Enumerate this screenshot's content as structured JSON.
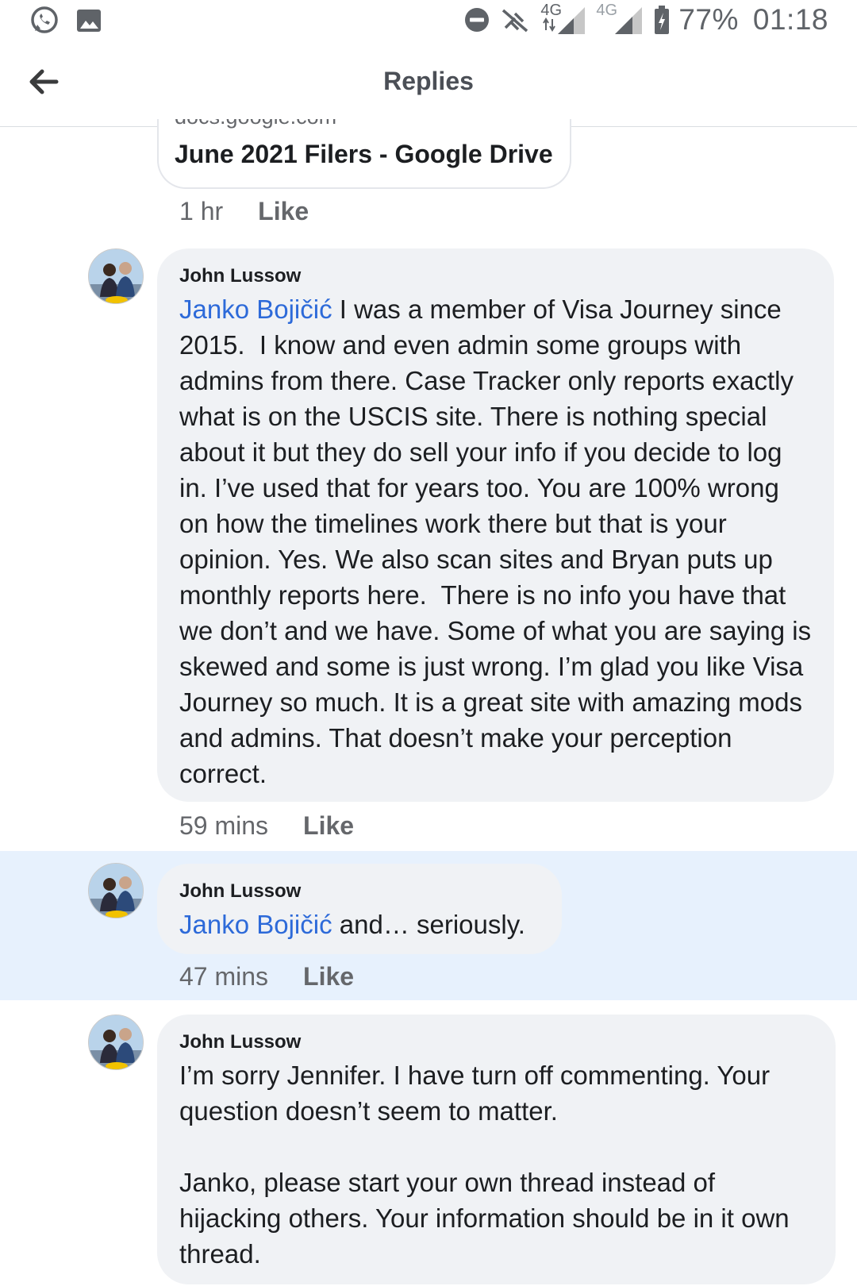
{
  "status_bar": {
    "network_label": "4G",
    "network2_label": "4G",
    "battery": "77%",
    "time": "01:18"
  },
  "header": {
    "title": "Replies"
  },
  "link_card": {
    "domain": "docs.google.com",
    "title": "June 2021 Filers - Google Drive",
    "time": "1 hr",
    "like": "Like"
  },
  "comments": [
    {
      "author": "John Lussow",
      "mention": "Janko Bojičić",
      "text": " I was a member of Visa Journey since 2015.  I know and even admin some groups with admins from there. Case Tracker only reports exactly what is on the USCIS site. There is nothing special about it but they do sell your info if you decide to log in. I’ve used that for years too. You are 100% wrong on how the timelines work there but that is your opinion. Yes. We also scan sites and Bryan puts up monthly reports here.  There is no info you have that we don’t and we have. Some of what you are saying is skewed and some is just wrong. I’m glad you like Visa Journey so much. It is a great site with amazing mods and admins. That doesn’t make your perception correct.",
      "time": "59 mins",
      "like": "Like"
    },
    {
      "author": "John Lussow",
      "mention": "Janko Bojičić",
      "text": " and… seriously.",
      "time": "47 mins",
      "like": "Like"
    },
    {
      "author": "John Lussow",
      "text": "I’m sorry Jennifer. I have turn off commenting. Your question doesn’t seem to matter.\n\nJanko, please start your own thread instead of hijacking others. Your information should be in it own thread."
    }
  ]
}
